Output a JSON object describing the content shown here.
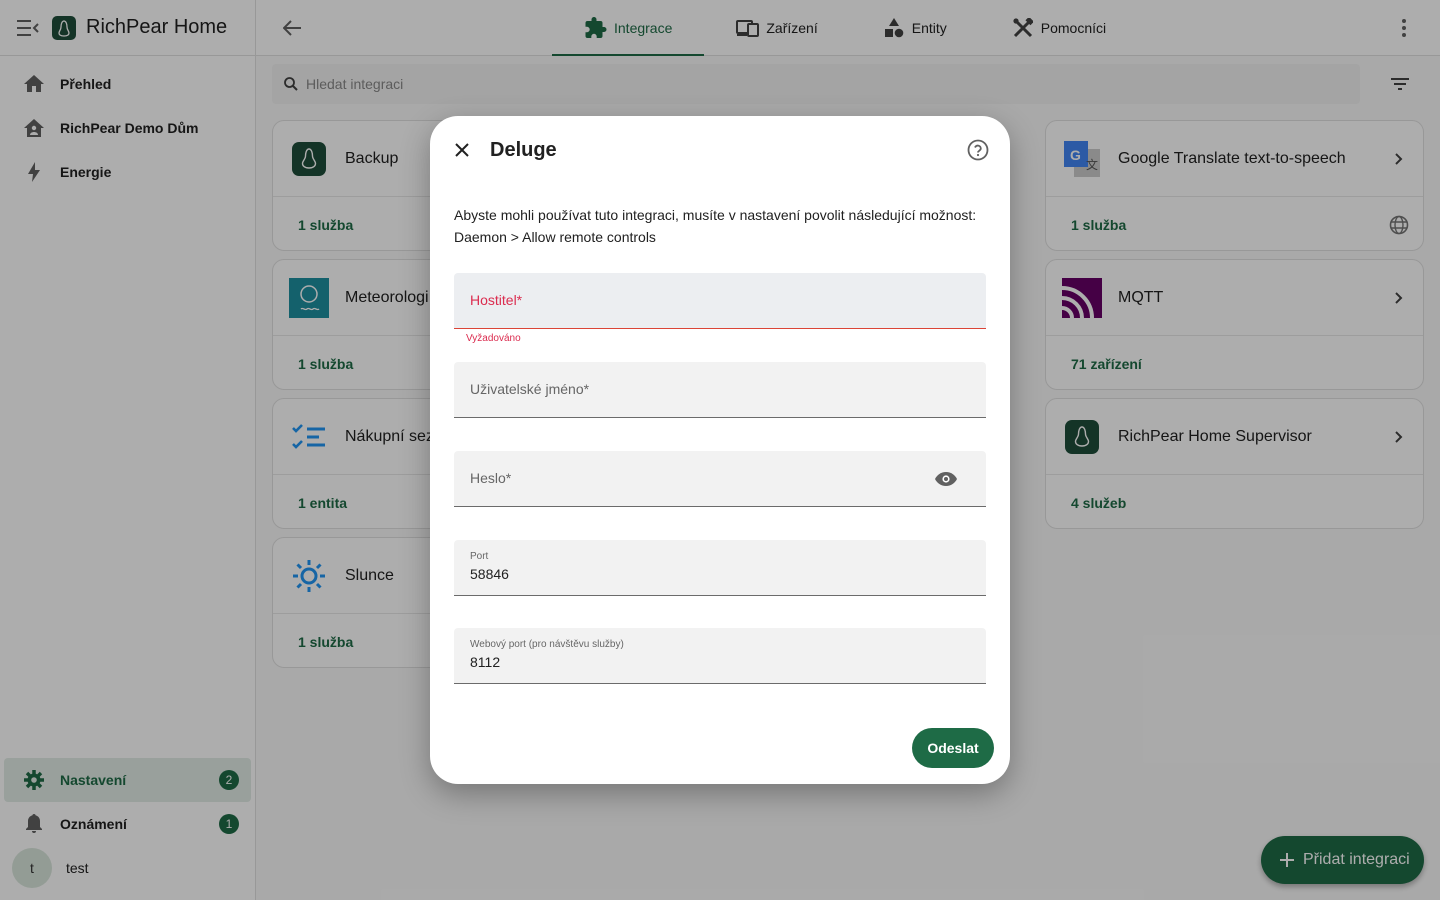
{
  "app": {
    "title": "RichPear Home"
  },
  "sidebar": {
    "items": [
      {
        "label": "Přehled",
        "icon": "home-icon"
      },
      {
        "label": "RichPear Demo Dům",
        "icon": "home-account-icon"
      },
      {
        "label": "Energie",
        "icon": "lightning-icon"
      }
    ],
    "bottom": {
      "settings": {
        "label": "Nastavení",
        "badge": "2"
      },
      "notifications": {
        "label": "Oznámení",
        "badge": "1"
      },
      "user": {
        "initial": "t",
        "name": "test"
      }
    }
  },
  "tabs": [
    {
      "label": "Integrace",
      "active": true
    },
    {
      "label": "Zařízení"
    },
    {
      "label": "Entity"
    },
    {
      "label": "Pomocníci"
    }
  ],
  "search": {
    "placeholder": "Hledat integraci"
  },
  "cards": [
    {
      "name": "Backup",
      "footer": "1 služba"
    },
    {
      "name": "Google Translate text-to-speech",
      "footer": "1 služba"
    },
    {
      "name": "Meteorologi",
      "footer": "1 služba"
    },
    {
      "name": "MQTT",
      "footer": "71 zařízení"
    },
    {
      "name": "Nákupní sez",
      "footer": "1 entita"
    },
    {
      "name": "RichPear Home Supervisor",
      "footer": "4 služeb"
    },
    {
      "name": "Slunce",
      "footer": "1 služba"
    }
  ],
  "fab": {
    "label": "Přidat integraci"
  },
  "dialog": {
    "title": "Deluge",
    "description_line1": "Abyste mohli používat tuto integraci, musíte v nastavení povolit následující možnost:",
    "description_line2": "Daemon > Allow remote controls",
    "fields": {
      "host": {
        "label": "Hostitel*",
        "helper": "Vyžadováno"
      },
      "username": {
        "label": "Uživatelské jméno*"
      },
      "password": {
        "label": "Heslo*"
      },
      "port": {
        "label": "Port",
        "value": "58846"
      },
      "web_port": {
        "label": "Webový port (pro návštěvu služby)",
        "value": "8112"
      }
    },
    "submit_label": "Odeslat"
  },
  "colors": {
    "accent": "#1e6b46",
    "error": "#db2c4f"
  }
}
